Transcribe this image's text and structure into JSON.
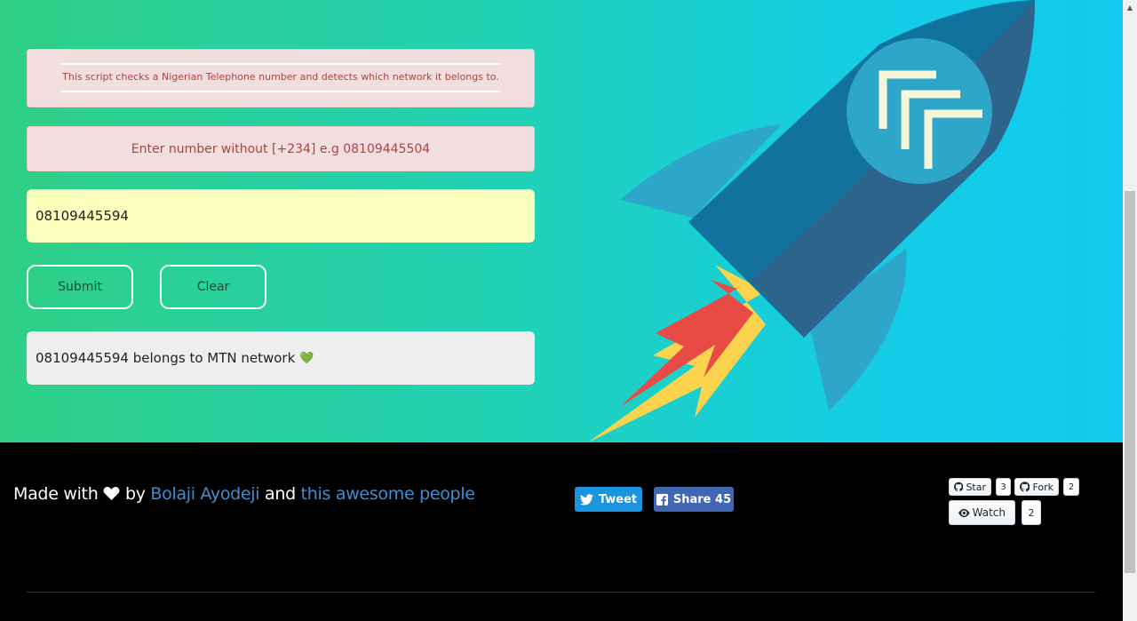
{
  "info": {
    "text": "This script checks a Nigerian Telephone number and detects which network it belongs to."
  },
  "hint": {
    "text": "Enter number without [+234] e.g 08109445504"
  },
  "form": {
    "phone_value": "08109445594",
    "submit_label": "Submit",
    "clear_label": "Clear"
  },
  "result": {
    "text": "08109445594 belongs to MTN network",
    "emoji": "💚"
  },
  "footer": {
    "made_with": "Made with",
    "by": "by",
    "author": "Bolaji Ayodeji",
    "and": "and",
    "contributors": "this awesome people"
  },
  "social": {
    "tweet_label": "Tweet",
    "share_label": "Share 45"
  },
  "github": {
    "star_label": "Star",
    "star_count": "3",
    "fork_label": "Fork",
    "fork_count": "2",
    "watch_label": "Watch",
    "watch_count": "2"
  },
  "colors": {
    "link": "#3d8fd1",
    "alert_text": "#a94442",
    "alert_bg": "#f2dede",
    "input_bg": "#faffbd",
    "tweet_bg": "#1b95e0",
    "share_bg": "#4267b2"
  }
}
